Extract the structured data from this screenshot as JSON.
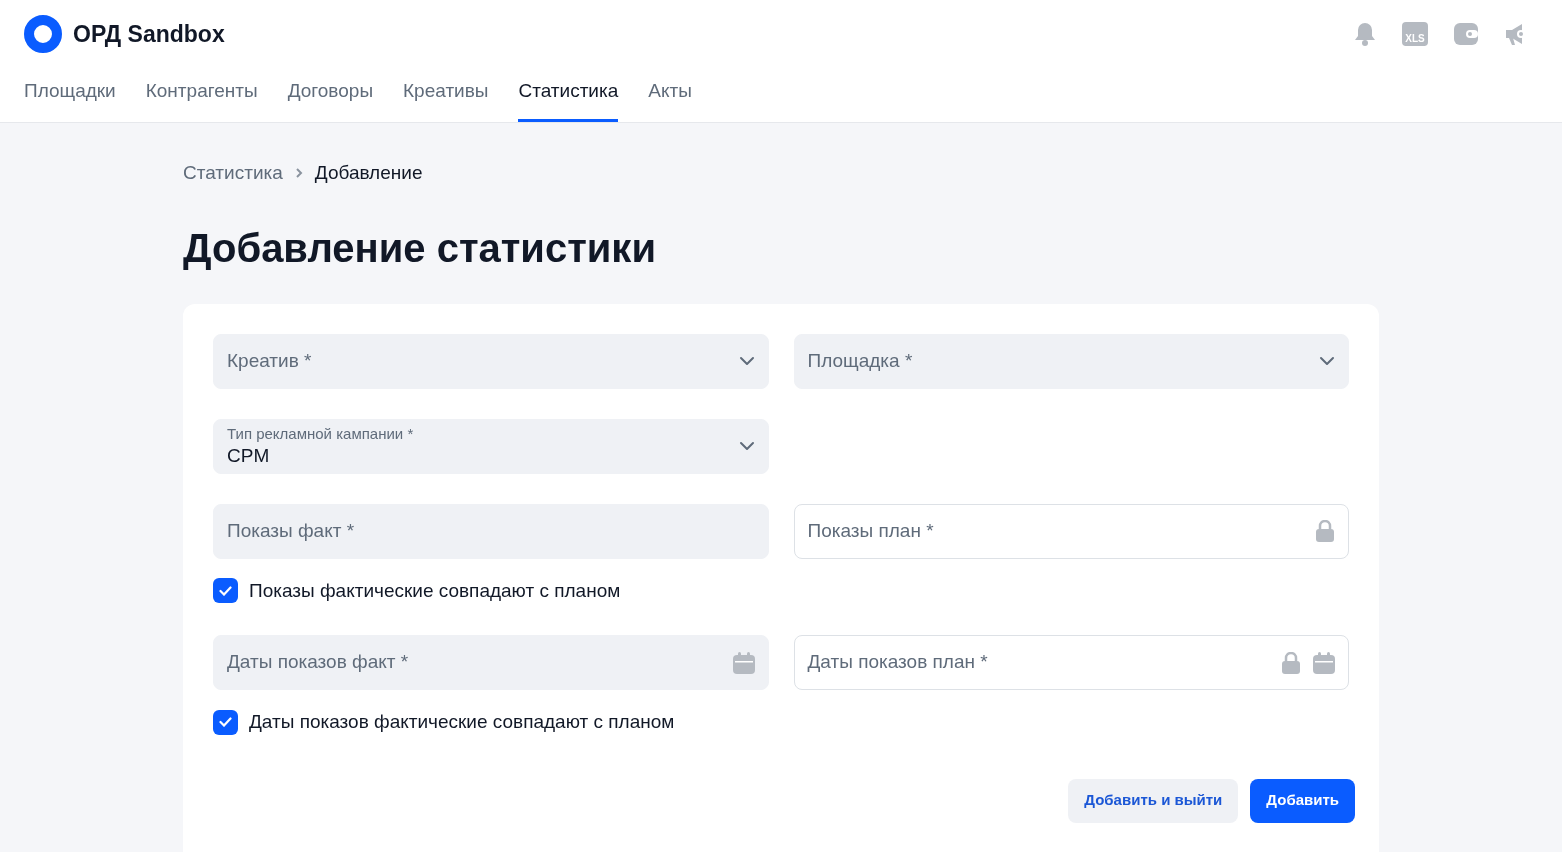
{
  "header": {
    "logo_text": "ОРД Sandbox",
    "xls_label": "XLS"
  },
  "tabs": [
    {
      "label": "Площадки",
      "selected": false
    },
    {
      "label": "Контрагенты",
      "selected": false
    },
    {
      "label": "Договоры",
      "selected": false
    },
    {
      "label": "Креативы",
      "selected": false
    },
    {
      "label": "Статистика",
      "selected": true
    },
    {
      "label": "Акты",
      "selected": false
    }
  ],
  "breadcrumbs": [
    "Статистика",
    "Добавление"
  ],
  "title": "Добавление статистики",
  "rows": [
    {
      "left": {
        "kind": "select",
        "placeholder": "Креатив *"
      },
      "right": {
        "kind": "select",
        "placeholder": "Площадка *"
      }
    },
    {
      "left": {
        "kind": "select",
        "label": "Тип рекламной кампании *",
        "value": "CPM"
      }
    },
    {
      "left": {
        "kind": "input",
        "placeholder": "Показы факт *"
      },
      "right": {
        "kind": "input",
        "placeholder": "Показы план *",
        "disabled": true
      },
      "checkbox": {
        "label": "Показы фактические совпадают с планом",
        "checked": true
      }
    },
    {
      "left": {
        "kind": "date",
        "placeholder": "Даты показов факт *"
      },
      "right": {
        "kind": "date",
        "placeholder": "Даты показов план *",
        "disabled": true
      },
      "checkbox": {
        "label": "Даты показов фактические совпадают с планом",
        "checked": true
      }
    }
  ],
  "buttons": [
    {
      "label": "Добавить и выйти",
      "kind": "secondary"
    },
    {
      "label": "Добавить",
      "kind": "primary"
    }
  ]
}
